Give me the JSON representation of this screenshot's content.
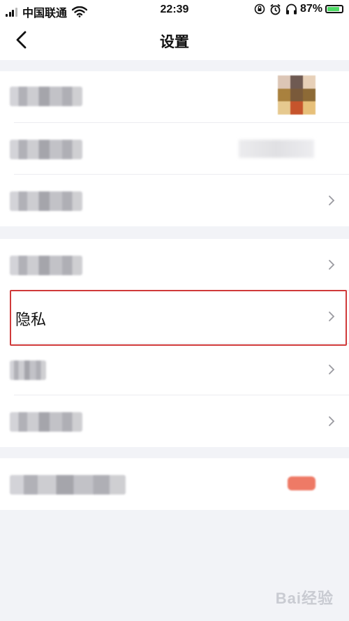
{
  "status_bar": {
    "carrier": "中国联通",
    "time": "22:39",
    "battery": "87%",
    "battery_level": 0.87
  },
  "nav": {
    "title": "设置"
  },
  "groups": {
    "privacy_label": "隐私"
  },
  "watermark": "Bai经验"
}
